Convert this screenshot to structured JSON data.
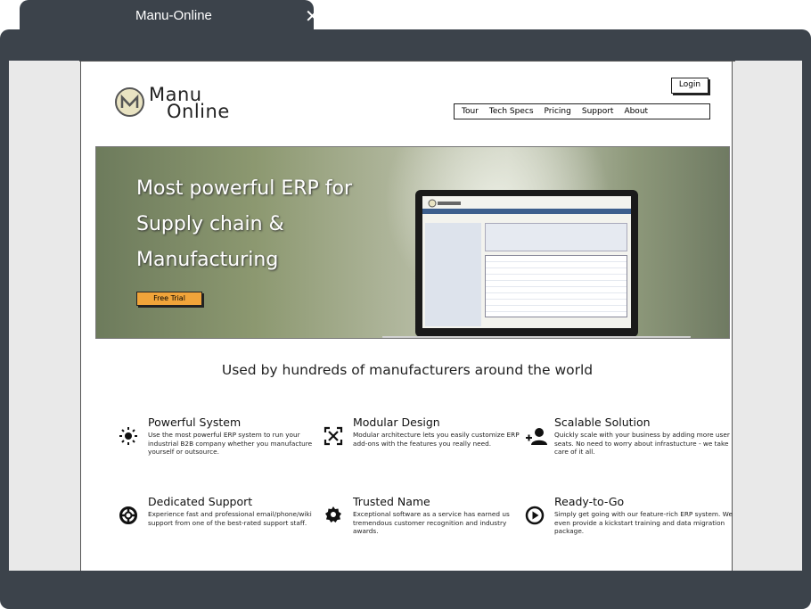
{
  "browser": {
    "tab_title": "Manu-Online",
    "close_label": "✕"
  },
  "logo": {
    "line1": "Manu",
    "line2": "Online"
  },
  "header": {
    "login_label": "Login",
    "nav": [
      "Tour",
      "Tech Specs",
      "Pricing",
      "Support",
      "About"
    ]
  },
  "hero": {
    "lines": [
      "Most powerful ERP for",
      "Supply chain &",
      "Manufacturing"
    ],
    "cta_label": "Free Trial"
  },
  "tagline": "Used by hundreds of manufacturers around the world",
  "features": [
    {
      "icon": "sun-icon",
      "glyph": "☀",
      "title": "Powerful System",
      "desc": "Use the most powerful ERP system to run your industrial B2B company whether you manufacture yourself or outsource."
    },
    {
      "icon": "modular-icon",
      "glyph": "⧉",
      "title": "Modular Design",
      "desc": "Modular architecture lets you easily customize ERP add-ons with the features you really need."
    },
    {
      "icon": "add-user-icon",
      "glyph": "+👤",
      "title": "Scalable Solution",
      "desc": "Quickly scale with your business by adding more user seats. No need to worry about infrastucture - we take care of it all."
    },
    {
      "icon": "lifebuoy-icon",
      "glyph": "⛑",
      "title": "Dedicated Support",
      "desc": "Experience fast and professional email/phone/wiki support from one of the best-rated support staff."
    },
    {
      "icon": "award-icon",
      "glyph": "✪",
      "title": "Trusted Name",
      "desc": "Exceptional software as a service has earned us tremendous customer recognition and industry awards."
    },
    {
      "icon": "play-icon",
      "glyph": "▶",
      "title": "Ready-to-Go",
      "desc": "Simply get going with our feature-rich ERP system. We even provide a kickstart training and data migration package."
    }
  ]
}
